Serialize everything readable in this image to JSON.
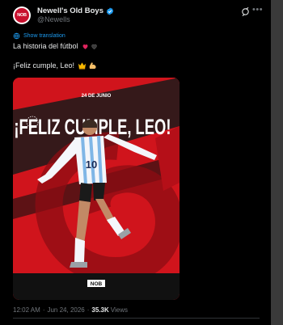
{
  "account": {
    "display_name": "Newell's Old Boys",
    "handle": "@Newells",
    "avatar_text": "NOB"
  },
  "post": {
    "show_translation": "Show translation",
    "line1": "La historia del fútbol",
    "line2": "¡Feliz cumple, Leo!"
  },
  "media": {
    "date_text": "24 DE JUNIO",
    "headline": "¡FELIZ CUMPLE, LEO!",
    "jersey_number": "10",
    "badge_text": "NOB",
    "icon": "birthday-graphic"
  },
  "meta": {
    "time": "12:02 AM",
    "date": "Jun 24, 2026",
    "views_count": "35.3K",
    "views_label": "Views",
    "separator": "·"
  },
  "colors": {
    "background": "#000000",
    "text": "#e7e9ea",
    "muted": "#71767b",
    "link": "#1d9bf0",
    "brand_red": "#c8102e"
  }
}
